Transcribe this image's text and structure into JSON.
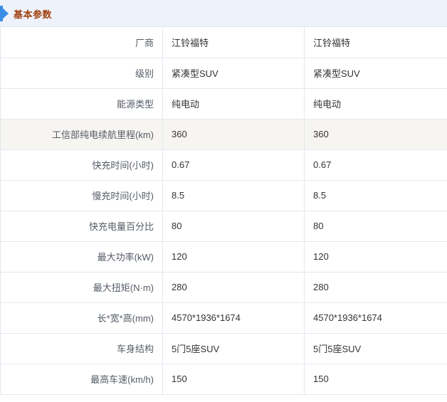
{
  "section": {
    "title": "基本参数"
  },
  "rows": [
    {
      "label": "厂商",
      "v1": "江铃福特",
      "v2": "江铃福特"
    },
    {
      "label": "级别",
      "v1": "紧凑型SUV",
      "v2": "紧凑型SUV"
    },
    {
      "label": "能源类型",
      "v1": "纯电动",
      "v2": "纯电动"
    },
    {
      "label": "工信部纯电续航里程(km)",
      "v1": "360",
      "v2": "360"
    },
    {
      "label": "快充时间(小时)",
      "v1": "0.67",
      "v2": "0.67"
    },
    {
      "label": "慢充时间(小时)",
      "v1": "8.5",
      "v2": "8.5"
    },
    {
      "label": "快充电量百分比",
      "v1": "80",
      "v2": "80"
    },
    {
      "label": "最大功率(kW)",
      "v1": "120",
      "v2": "120"
    },
    {
      "label": "最大扭矩(N·m)",
      "v1": "280",
      "v2": "280"
    },
    {
      "label": "长*宽*高(mm)",
      "v1": "4570*1936*1674",
      "v2": "4570*1936*1674"
    },
    {
      "label": "车身结构",
      "v1": "5门5座SUV",
      "v2": "5门5座SUV"
    },
    {
      "label": "最高车速(km/h)",
      "v1": "150",
      "v2": "150"
    }
  ],
  "colors": {
    "accent": "#3a8ee6",
    "title": "#a04010",
    "highlight_row": "#f7f5f1",
    "border": "#e3e8ef"
  }
}
